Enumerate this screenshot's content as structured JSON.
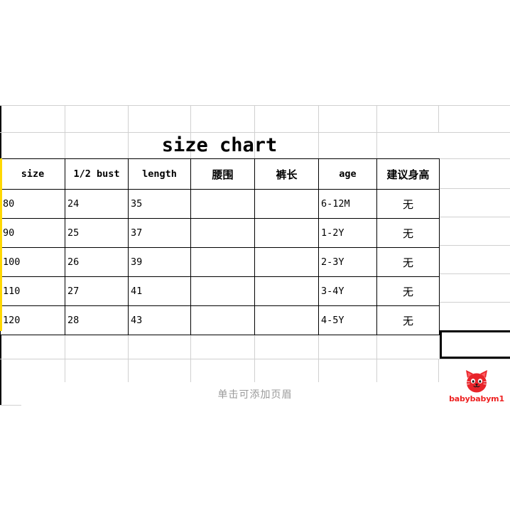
{
  "document": {
    "title": "size chart",
    "header_hint": "单击可添加页眉"
  },
  "watermark": {
    "icon": "cat-face-icon",
    "brand": "babybabym1",
    "color": "#ee2222"
  },
  "accent": {
    "selection_border": "#000000",
    "row_marker": "#ffd800",
    "gridline": "#d0d0d0"
  },
  "chart_data": {
    "type": "table",
    "title": "size chart",
    "columns": [
      "size",
      "1/2 bust",
      "length",
      "腰围",
      "裤长",
      "age",
      "建议身高"
    ],
    "rows": [
      [
        "80",
        "24",
        "35",
        "",
        "",
        "6-12M",
        "无"
      ],
      [
        "90",
        "25",
        "37",
        "",
        "",
        "1-2Y",
        "无"
      ],
      [
        "100",
        "26",
        "39",
        "",
        "",
        "2-3Y",
        "无"
      ],
      [
        "110",
        "27",
        "41",
        "",
        "",
        "3-4Y",
        "无"
      ],
      [
        "120",
        "28",
        "43",
        "",
        "",
        "4-5Y",
        "无"
      ]
    ]
  },
  "table": {
    "headers": [
      {
        "label": "size",
        "cjk": false
      },
      {
        "label": "1/2 bust",
        "cjk": false
      },
      {
        "label": "length",
        "cjk": false
      },
      {
        "label": "腰围",
        "cjk": true
      },
      {
        "label": "裤长",
        "cjk": true
      },
      {
        "label": "age",
        "cjk": false
      },
      {
        "label": "建议身高",
        "cjk": true
      }
    ],
    "rows": [
      {
        "size": "80",
        "bust": "24",
        "length": "35",
        "waist": "",
        "pants": "",
        "age": "6-12M",
        "height": "无"
      },
      {
        "size": "90",
        "bust": "25",
        "length": "37",
        "waist": "",
        "pants": "",
        "age": "1-2Y",
        "height": "无"
      },
      {
        "size": "100",
        "bust": "26",
        "length": "39",
        "waist": "",
        "pants": "",
        "age": "2-3Y",
        "height": "无"
      },
      {
        "size": "110",
        "bust": "27",
        "length": "41",
        "waist": "",
        "pants": "",
        "age": "3-4Y",
        "height": "无"
      },
      {
        "size": "120",
        "bust": "28",
        "length": "43",
        "waist": "",
        "pants": "",
        "age": "4-5Y",
        "height": "无"
      }
    ]
  }
}
